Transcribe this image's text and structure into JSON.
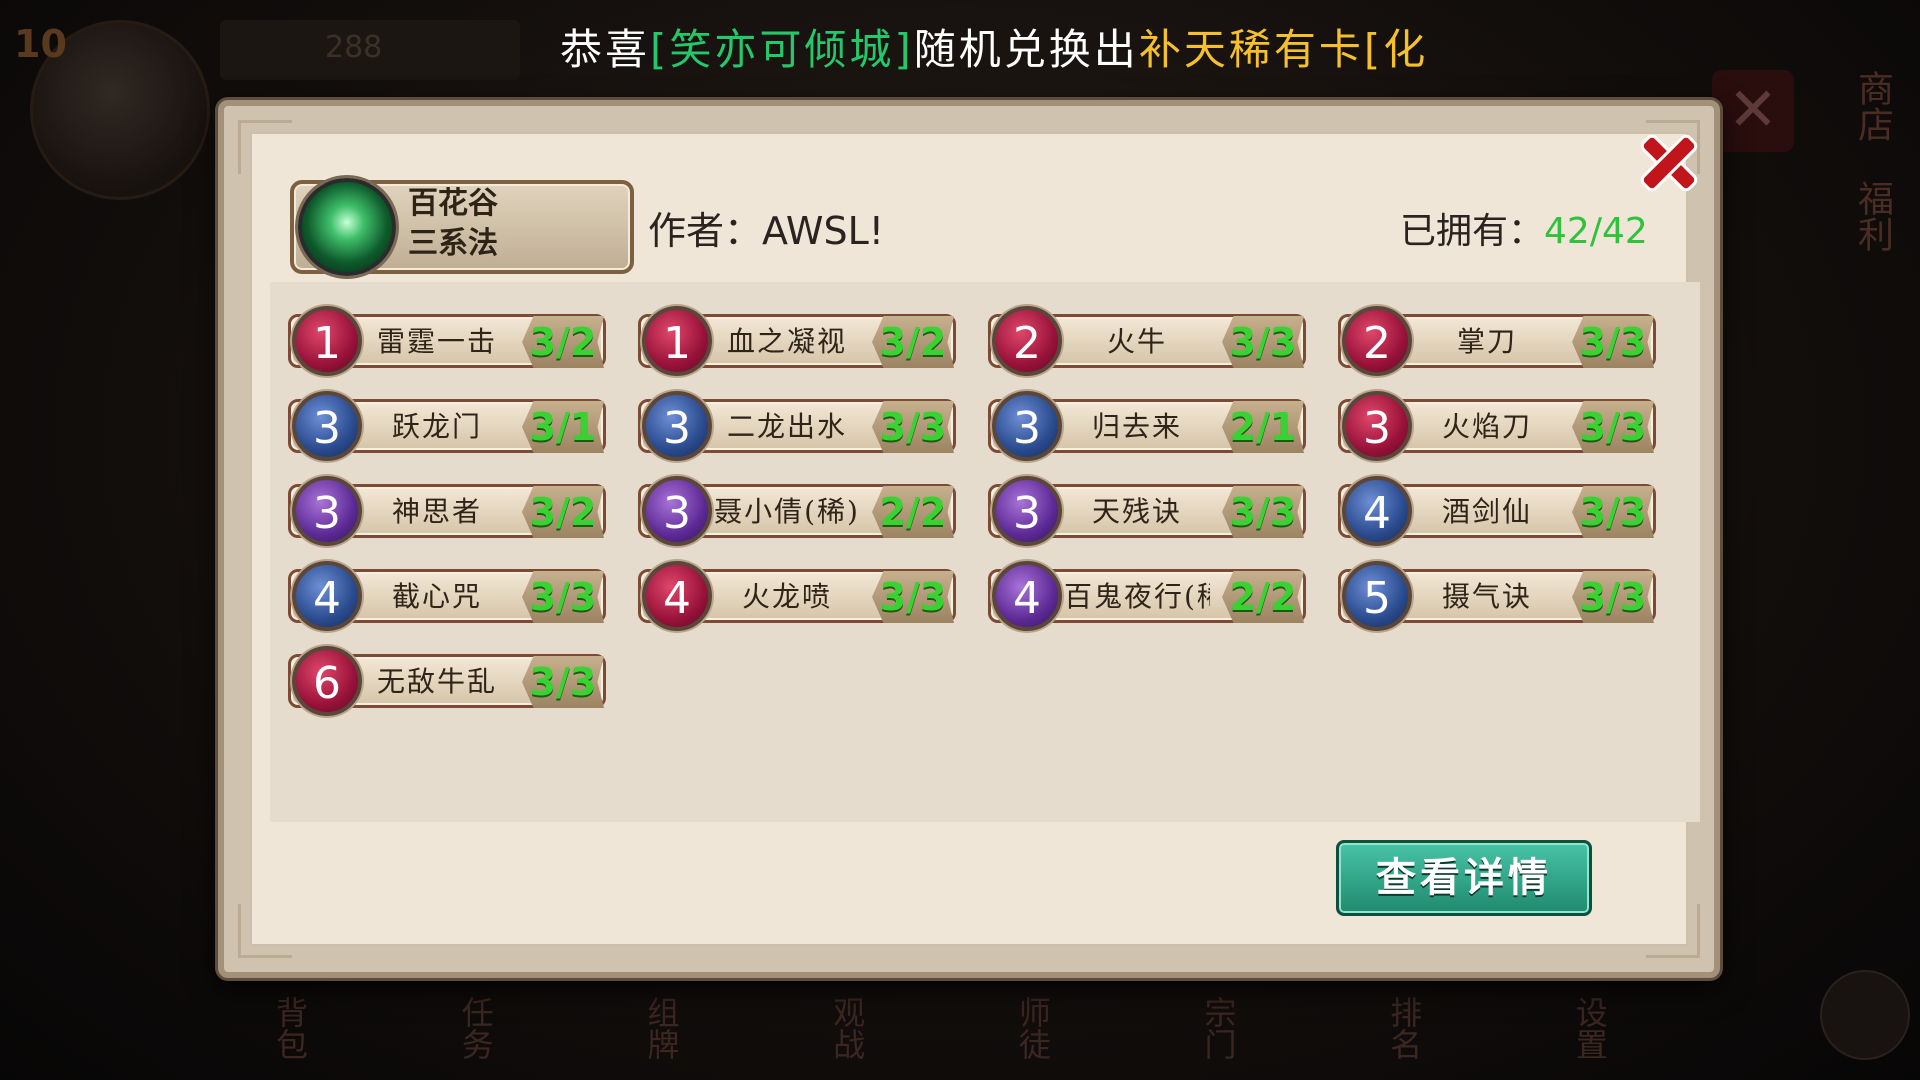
{
  "background": {
    "level": "10",
    "topbar_value": "288",
    "side_labels": [
      "商店",
      "福利"
    ],
    "bottom_nav": [
      "背包",
      "任务",
      "组牌",
      "观战",
      "师徒",
      "宗门",
      "排名",
      "设置"
    ]
  },
  "announcement": {
    "part1": "恭喜",
    "player": "[笑亦可倾城]",
    "part2": "随机兑换出",
    "item": "补天稀有卡[化"
  },
  "deck": {
    "name_line1": "百花谷",
    "name_line2": "三系法",
    "author_label": "作者：",
    "author": "AWSL!",
    "owned_label": "已拥有：",
    "owned_value": "42/42"
  },
  "cards": [
    {
      "cost": "1",
      "color": "red",
      "name": "雷霆一击",
      "count": "3/2"
    },
    {
      "cost": "1",
      "color": "red",
      "name": "血之凝视",
      "count": "3/2"
    },
    {
      "cost": "2",
      "color": "red",
      "name": "火牛",
      "count": "3/3"
    },
    {
      "cost": "2",
      "color": "red",
      "name": "掌刀",
      "count": "3/3"
    },
    {
      "cost": "3",
      "color": "blue",
      "name": "跃龙门",
      "count": "3/1"
    },
    {
      "cost": "3",
      "color": "blue",
      "name": "二龙出水",
      "count": "3/3"
    },
    {
      "cost": "3",
      "color": "blue",
      "name": "归去来",
      "count": "2/1"
    },
    {
      "cost": "3",
      "color": "red",
      "name": "火焰刀",
      "count": "3/3"
    },
    {
      "cost": "3",
      "color": "purple",
      "name": "神思者",
      "count": "3/2"
    },
    {
      "cost": "3",
      "color": "purple",
      "name": "聂小倩(稀)",
      "count": "2/2"
    },
    {
      "cost": "3",
      "color": "purple",
      "name": "天残诀",
      "count": "3/3"
    },
    {
      "cost": "4",
      "color": "blue",
      "name": "酒剑仙",
      "count": "3/3"
    },
    {
      "cost": "4",
      "color": "blue",
      "name": "截心咒",
      "count": "3/3"
    },
    {
      "cost": "4",
      "color": "red",
      "name": "火龙喷",
      "count": "3/3"
    },
    {
      "cost": "4",
      "color": "purple",
      "name": "百鬼夜行(稀",
      "count": "2/2"
    },
    {
      "cost": "5",
      "color": "blue",
      "name": "摄气诀",
      "count": "3/3"
    },
    {
      "cost": "6",
      "color": "red",
      "name": "无敌牛乱",
      "count": "3/3"
    }
  ],
  "detail_button": "查看详情",
  "colors": {
    "count_green": "#3ad233",
    "owned_green": "#2fc23a",
    "button_teal": "#2ea587",
    "close_red": "#c0161b"
  }
}
